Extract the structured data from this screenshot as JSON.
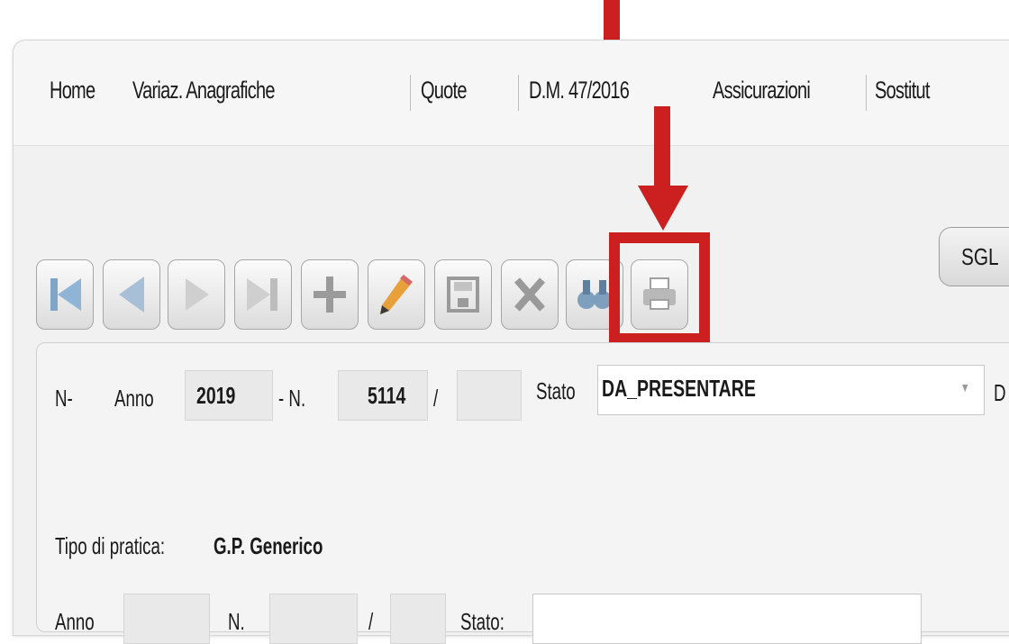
{
  "menu": {
    "items": [
      {
        "label": "Home"
      },
      {
        "label": "Variaz. Anagrafiche"
      },
      {
        "label": "Quote"
      },
      {
        "label": "D.M. 47/2016"
      },
      {
        "label": "Assicurazioni"
      },
      {
        "label": "Sostitut"
      }
    ]
  },
  "top_button": {
    "label": "SGL"
  },
  "toolbar": {
    "buttons": [
      {
        "icon": "first-record-icon"
      },
      {
        "icon": "previous-record-icon"
      },
      {
        "icon": "next-record-icon"
      },
      {
        "icon": "last-record-icon"
      },
      {
        "icon": "add-icon"
      },
      {
        "icon": "edit-pencil-icon"
      },
      {
        "icon": "save-icon"
      },
      {
        "icon": "delete-x-icon"
      },
      {
        "icon": "search-binoculars-icon"
      },
      {
        "icon": "print-icon"
      }
    ]
  },
  "form": {
    "prefix": "N-",
    "anno_label": "Anno",
    "anno_value": "2019",
    "n_label": "- N.",
    "n_value": "5114",
    "slash": "/",
    "suffix_value": "",
    "stato_label": "Stato",
    "stato_value": "DA_PRESENTARE",
    "trailing_letter": "D",
    "tipo_label": "Tipo di pratica:",
    "tipo_value": "G.P. Generico",
    "row2": {
      "anno_label": "Anno",
      "n_label": "N.",
      "slash": "/",
      "stato_label": "Stato:"
    }
  },
  "colors": {
    "annotation_red": "#cc1f1f",
    "panel_bg": "#f1f1f1"
  }
}
